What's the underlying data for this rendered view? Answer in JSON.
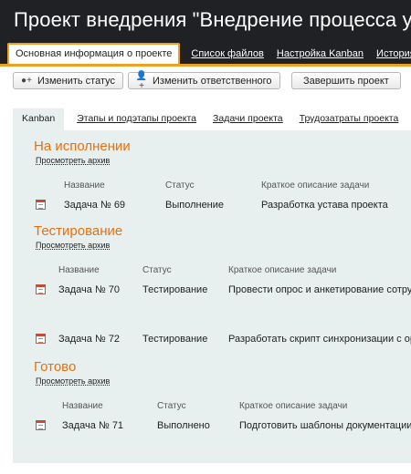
{
  "app": {
    "title": "Проект внедрения \"Внедрение процесса у"
  },
  "tabs": [
    {
      "label": "Основная информация о проекте",
      "active": true
    },
    {
      "label": "Список файлов"
    },
    {
      "label": "Настройка Kanban"
    },
    {
      "label": "История из"
    }
  ],
  "toolbar": {
    "change_status": "Изменить статус",
    "change_assignee": "Изменить ответственного",
    "finish_project": "Завершить проект"
  },
  "subtabs": [
    {
      "label": "Kanban",
      "active": true
    },
    {
      "label": "Этапы и подэтапы проекта"
    },
    {
      "label": "Задачи проекта"
    },
    {
      "label": "Трудозатраты проекта"
    },
    {
      "label": "У"
    }
  ],
  "sections": [
    {
      "title": "На исполнении",
      "archive_link": "Просмотреть архив",
      "headers": [
        "Название",
        "Статус",
        "Краткое описание задачи"
      ],
      "rows": [
        {
          "name": "Задача № 69",
          "status": "Выполнение",
          "description": "Разработка устава проекта"
        }
      ]
    },
    {
      "title": "Тестирование",
      "archive_link": "Просмотреть архив",
      "headers": [
        "Название",
        "Статус",
        "Краткое описание задачи"
      ],
      "rows": [
        {
          "name": "Задача № 70",
          "status": "Тестирование",
          "description": "Провести опрос и анкетирование сотрудн"
        },
        {
          "name": "Задача № 72",
          "status": "Тестирование",
          "description": "Разработать скрипт синхронизации с орга"
        }
      ]
    },
    {
      "title": "Готово",
      "archive_link": "Просмотреть архив",
      "headers": [
        "Название",
        "Статус",
        "Краткое описание задачи"
      ],
      "rows": [
        {
          "name": "Задача № 71",
          "status": "Выполнено",
          "description": "Подготовить шаблоны документации"
        }
      ]
    }
  ],
  "colors": {
    "accent": "#f0a020",
    "section_title": "#e8700c",
    "topbar": "#1f2125",
    "panel": "#e8f0ef"
  }
}
